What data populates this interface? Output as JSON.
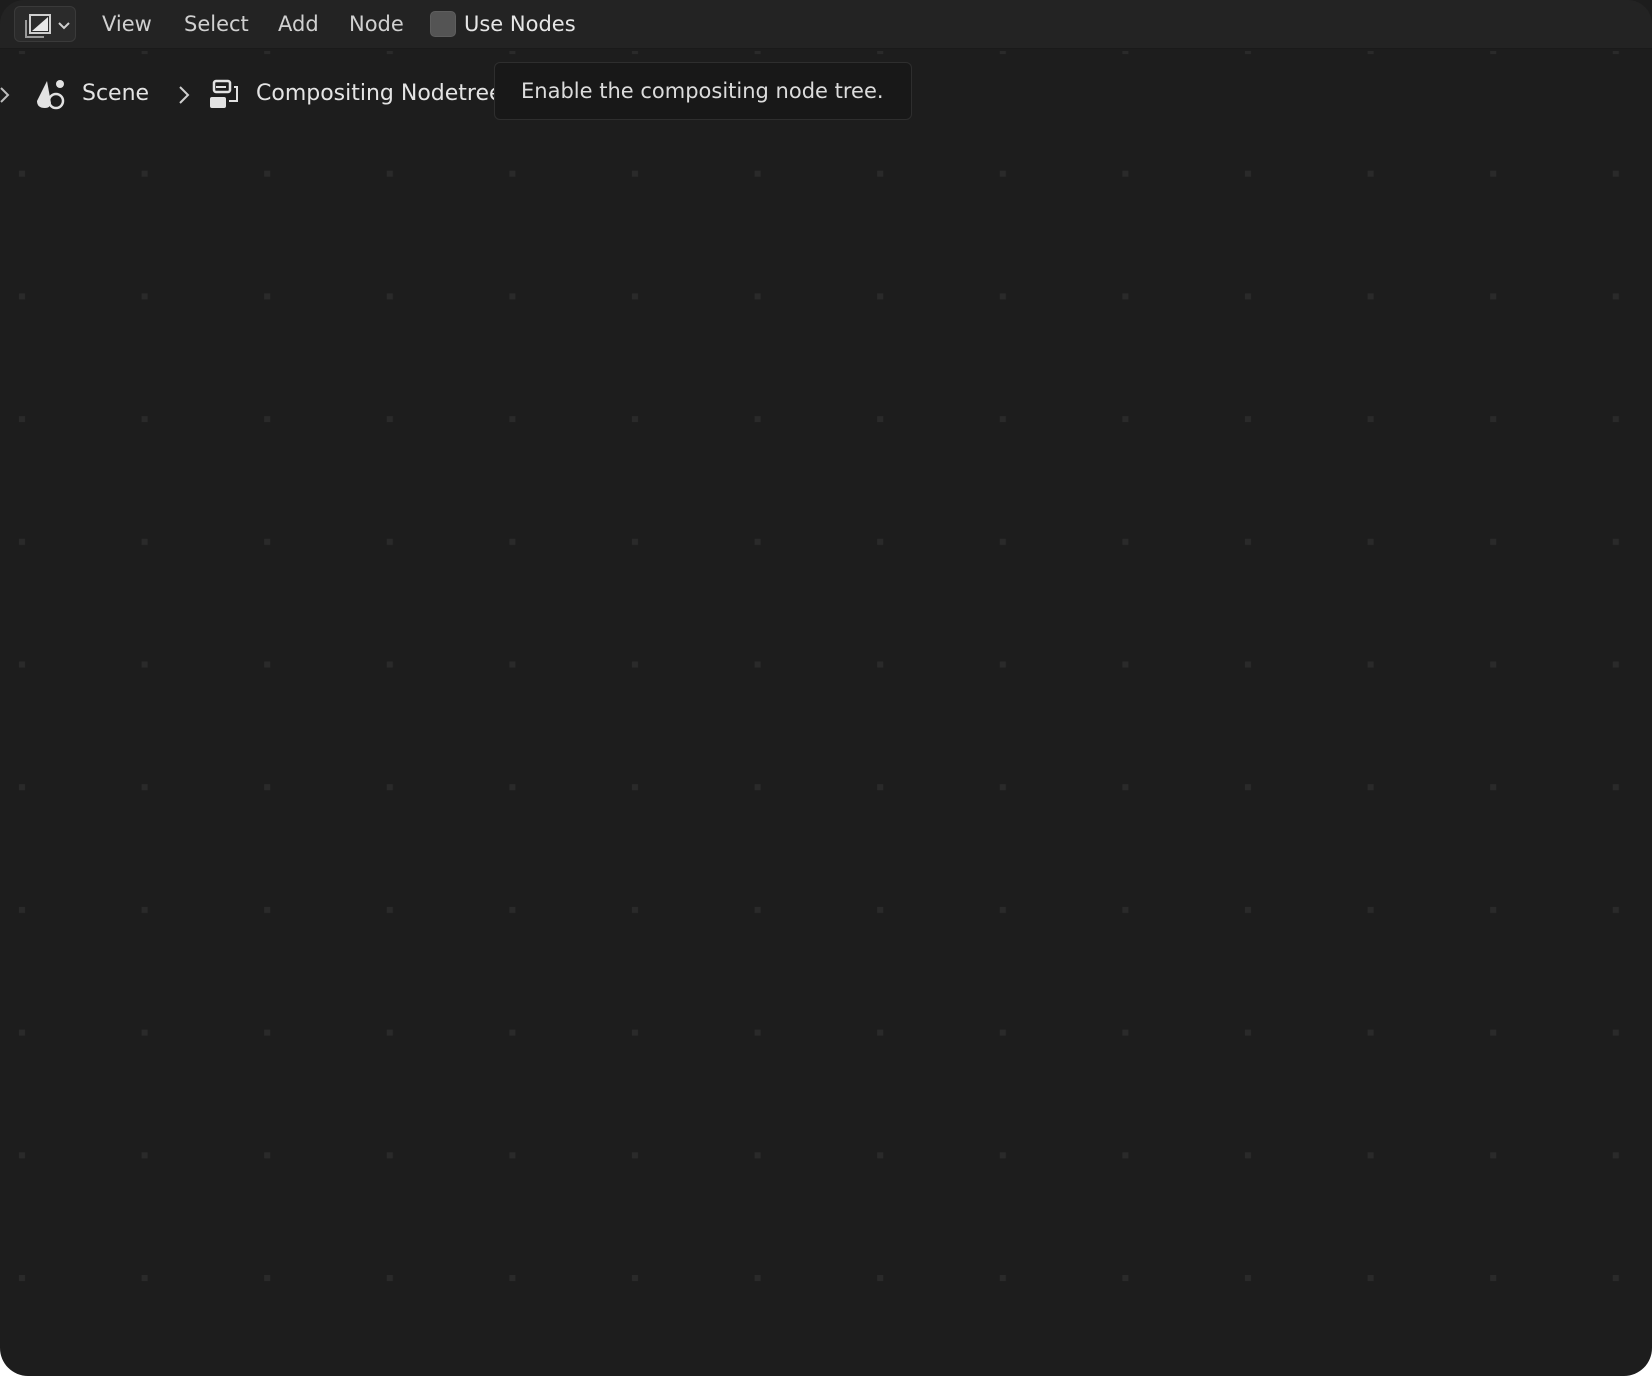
{
  "header": {
    "editor_type_icon": "compositor-icon",
    "menus": [
      "View",
      "Select",
      "Add",
      "Node"
    ],
    "use_nodes": {
      "label": "Use Nodes",
      "checked": false
    }
  },
  "breadcrumb": {
    "items": [
      {
        "icon": "scene-icon",
        "label": "Scene"
      },
      {
        "icon": "node-tree-icon",
        "label": "Compositing Nodetree"
      }
    ]
  },
  "tooltip": {
    "text": "Enable the compositing node tree."
  },
  "colors": {
    "background": "#1d1d1d",
    "header": "#232323",
    "grid_dot": "#2a2a2a",
    "text": "#d9d9d9"
  }
}
